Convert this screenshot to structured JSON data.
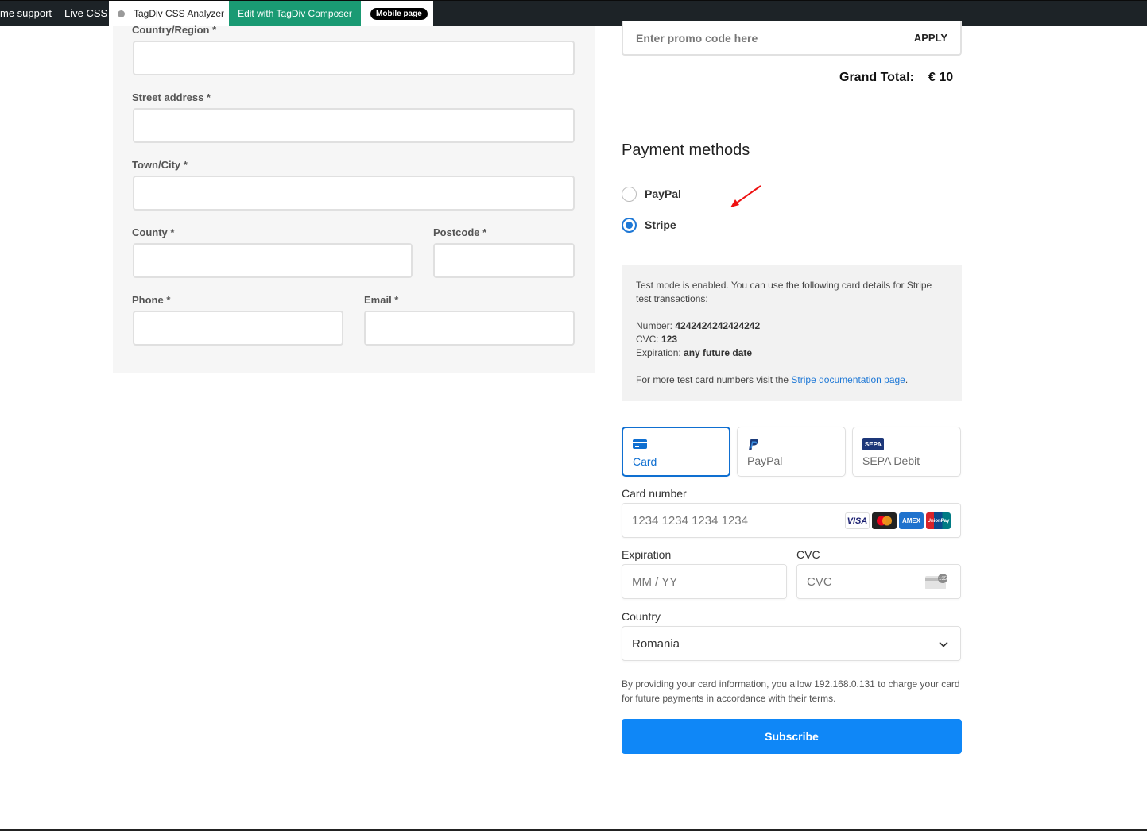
{
  "adminbar": {
    "support": "me support",
    "live_css": "Live CSS",
    "analyzer": "TagDiv CSS Analyzer",
    "composer": "Edit with TagDiv Composer",
    "mobile": "Mobile page"
  },
  "billing": {
    "country_label": "Country/Region *",
    "street_label": "Street address *",
    "town_label": "Town/City *",
    "county_label": "County *",
    "postcode_label": "Postcode *",
    "phone_label": "Phone *",
    "email_label": "Email *"
  },
  "order": {
    "promo_placeholder": "Enter promo code here",
    "promo_button": "APPLY",
    "grand_total_label": "Grand Total:",
    "grand_total_value": "€ 10"
  },
  "payment": {
    "title": "Payment methods",
    "options": [
      {
        "label": "PayPal",
        "selected": false
      },
      {
        "label": "Stripe",
        "selected": true
      }
    ]
  },
  "notice": {
    "line1": "Test mode is enabled. You can use the following card details for Stripe test transactions:",
    "number_label": "Number:",
    "number_value": "4242424242424242",
    "cvc_label": "CVC:",
    "cvc_value": "123",
    "expiration_label": "Expiration:",
    "expiration_value": "any future date",
    "more_text": "For more test card numbers visit the",
    "link_text": "Stripe documentation page",
    "period": "."
  },
  "stripe": {
    "tabs": [
      {
        "label": "Card",
        "active": true,
        "icon": "card-icon"
      },
      {
        "label": "PayPal",
        "active": false,
        "icon": "paypal-icon"
      },
      {
        "label": "SEPA Debit",
        "active": false,
        "icon": "sepa-icon"
      }
    ],
    "card_number_label": "Card number",
    "card_number_placeholder": "1234 1234 1234 1234",
    "brands": [
      "VISA",
      "",
      "AMEX",
      "UnionPay"
    ],
    "expiration_label": "Expiration",
    "expiration_placeholder": "MM / YY",
    "cvc_label": "CVC",
    "cvc_placeholder": "CVC",
    "cvc_badge": "135",
    "country_label": "Country",
    "country_value": "Romania",
    "terms": "By providing your card information, you allow 192.168.0.131 to charge your card for future payments in accordance with their terms.",
    "subscribe": "Subscribe"
  },
  "colors": {
    "accent": "#0f87f7",
    "tab_active": "#0f6fd1",
    "composer": "#1a9a73",
    "adminbar": "#1d2327"
  }
}
